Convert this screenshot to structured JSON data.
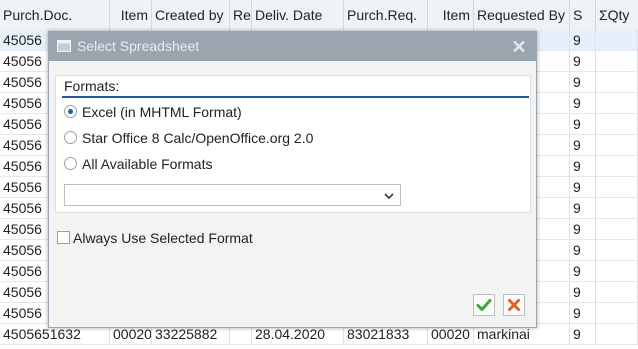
{
  "table": {
    "columns": [
      {
        "label": "Purch.Doc."
      },
      {
        "label": "Item"
      },
      {
        "label": "Created by"
      },
      {
        "label": "Rel"
      },
      {
        "label": "Deliv. Date"
      },
      {
        "label": "Purch.Req."
      },
      {
        "label": "Item"
      },
      {
        "label": "Requested By"
      },
      {
        "label": "S"
      },
      {
        "label": "ΣQty"
      }
    ],
    "rows": [
      {
        "doc": "45056",
        "s": "9"
      },
      {
        "doc": "45056",
        "s": "9"
      },
      {
        "doc": "45056",
        "s": "9"
      },
      {
        "doc": "45056",
        "s": "9"
      },
      {
        "doc": "45056",
        "s": "9"
      },
      {
        "doc": "45056",
        "s": "9"
      },
      {
        "doc": "45056",
        "s": "9"
      },
      {
        "doc": "45056",
        "s": "9"
      },
      {
        "doc": "45056",
        "s": "9"
      },
      {
        "doc": "45056",
        "s": "9"
      },
      {
        "doc": "45056",
        "s": "9"
      },
      {
        "doc": "45056",
        "s": "9"
      },
      {
        "doc": "45056",
        "s": "9"
      },
      {
        "doc": "45056",
        "s": "9"
      },
      {
        "doc": "4505651632",
        "item": "00020",
        "created": "33225882",
        "date": "28.04.2020",
        "req": "83021833",
        "reqitem": "00020",
        "by": "markinai",
        "s": "9"
      }
    ]
  },
  "dialog": {
    "title": "Select Spreadsheet",
    "close_icon": "close-icon",
    "formats_label": "Formats:",
    "options": [
      {
        "label": "Excel (in MHTML Format)",
        "checked": true
      },
      {
        "label": "Star Office 8 Calc/OpenOffice.org 2.0",
        "checked": false
      },
      {
        "label": "All Available Formats",
        "checked": false
      }
    ],
    "select_value": "",
    "always_label": "Always Use Selected Format",
    "always_checked": false,
    "ok_icon": "checkmark-icon",
    "cancel_icon": "cancel-x-icon"
  },
  "colors": {
    "titlebar": "#9aa5b0",
    "accent_line": "#1f5c99",
    "ok_green": "#3aa53a",
    "cancel_orange": "#e0602a"
  }
}
